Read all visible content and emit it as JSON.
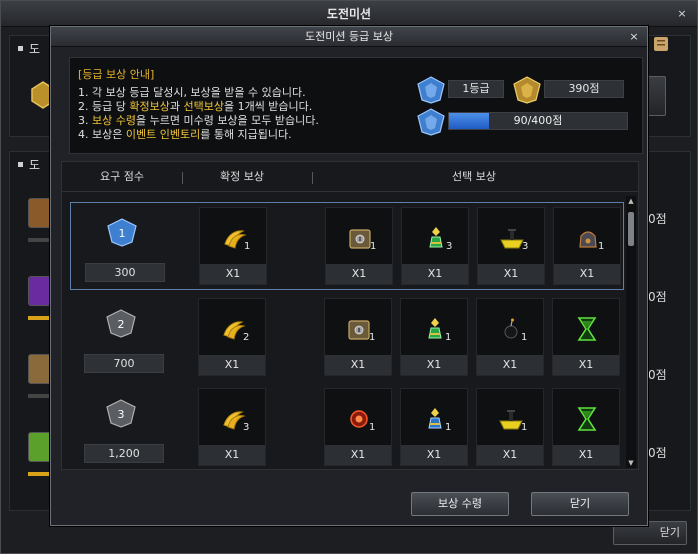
{
  "background_window": {
    "title": "도전미션",
    "section1_label": "도",
    "section2_label": "도",
    "side_values": [
      "0점",
      "0점",
      "0점",
      "0점"
    ],
    "bottom_button_label": "닫기"
  },
  "dialog": {
    "title": "도전미션 등급 보상",
    "close_glyph": "×",
    "info": {
      "heading": "[등급 보상 안내]",
      "lines": [
        {
          "parts": [
            "1. 각 보상 등급 달성시, 보상을 받을 수 있습니다."
          ]
        },
        {
          "parts": [
            "2. 등급 당 ",
            "확정보상",
            "과 ",
            "선택보상",
            "을 1개씩 받습니다."
          ]
        },
        {
          "parts": [
            "3. ",
            "보상 수령",
            "을 누르면 미수령 보상을 모두 받습니다."
          ]
        },
        {
          "parts": [
            "4. 보상은 ",
            "이벤트 인벤토리",
            "를 통해 지급됩니다."
          ]
        }
      ]
    },
    "status": {
      "grade": "1등급",
      "points": "390점",
      "progress_text": "90/400점",
      "progress_value": 90,
      "progress_max": 400
    },
    "table": {
      "headers": [
        "요구 점수",
        "확정 보상",
        "선택 보상"
      ],
      "rows": [
        {
          "level": "1",
          "score": "300",
          "selected": true,
          "fixed": {
            "icon": "banana-icon",
            "count": "1",
            "qty": "X1"
          },
          "choices": [
            {
              "icon": "treasure-box-icon",
              "count": "1",
              "qty": "X1"
            },
            {
              "icon": "green-potion-icon",
              "count": "3",
              "qty": "X1"
            },
            {
              "icon": "yellow-boat-icon",
              "count": "3",
              "qty": "X1"
            },
            {
              "icon": "grey-bag-icon",
              "count": "1",
              "qty": "X1"
            }
          ]
        },
        {
          "level": "2",
          "score": "700",
          "selected": false,
          "fixed": {
            "icon": "banana-icon",
            "count": "2",
            "qty": "X1"
          },
          "choices": [
            {
              "icon": "treasure-box-icon",
              "count": "1",
              "qty": "X1"
            },
            {
              "icon": "green-potion-icon",
              "count": "1",
              "qty": "X1"
            },
            {
              "icon": "black-bomb-icon",
              "count": "1",
              "qty": "X1"
            },
            {
              "icon": "hourglass-icon",
              "count": "",
              "qty": "X1"
            }
          ]
        },
        {
          "level": "3",
          "score": "1,200",
          "selected": false,
          "fixed": {
            "icon": "banana-icon",
            "count": "3",
            "qty": "X1"
          },
          "choices": [
            {
              "icon": "red-orb-icon",
              "count": "1",
              "qty": "X1"
            },
            {
              "icon": "blue-potion-icon",
              "count": "1",
              "qty": "X1"
            },
            {
              "icon": "yellow-boat-icon",
              "count": "1",
              "qty": "X1"
            },
            {
              "icon": "hourglass-icon",
              "count": "",
              "qty": "X1"
            }
          ]
        }
      ]
    },
    "buttons": {
      "claim": "보상 수령",
      "close": "닫기"
    },
    "colors": {
      "accent_gold": "#f0c53a",
      "progress_blue": "#2f74d8"
    }
  }
}
